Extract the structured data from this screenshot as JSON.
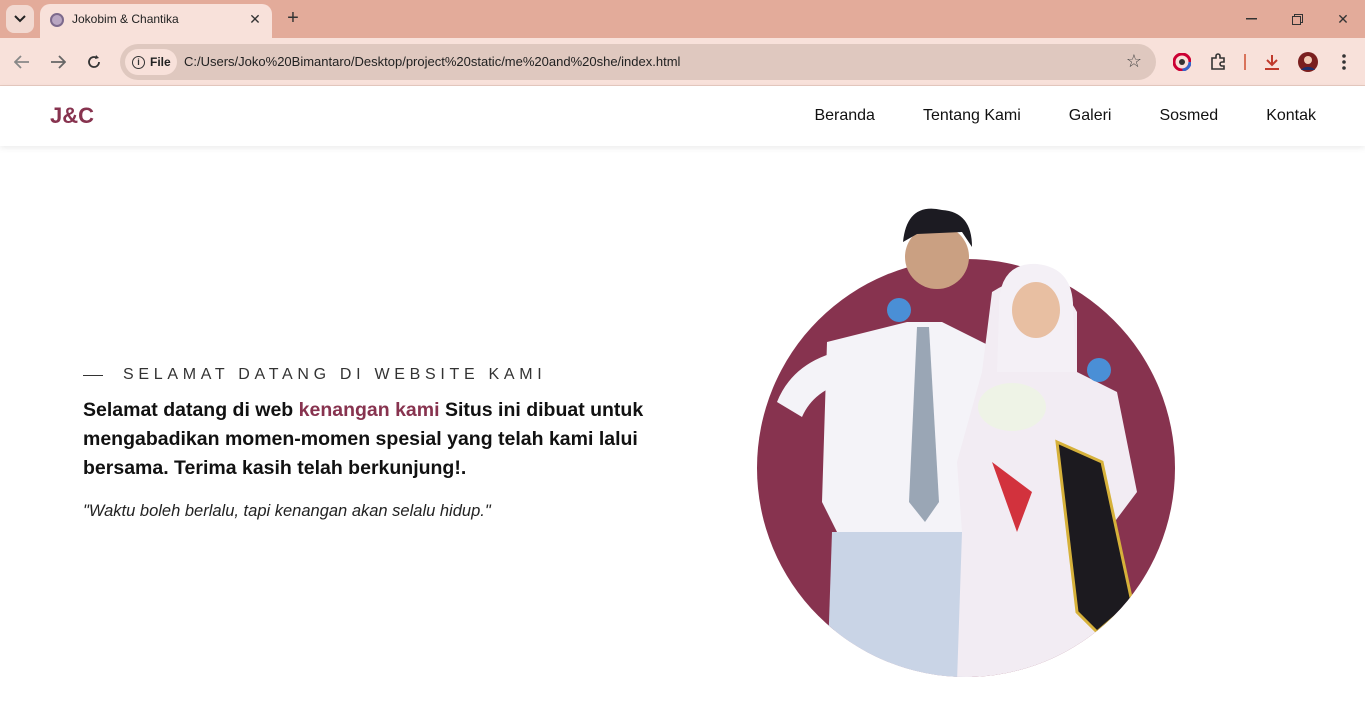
{
  "browser": {
    "tab_title": "Jokobim & Chantika",
    "file_label": "File",
    "url": "C:/Users/Joko%20Bimantaro/Desktop/project%20static/me%20and%20she/index.html"
  },
  "site": {
    "brand": "J&C",
    "menu": [
      "Beranda",
      "Tentang Kami",
      "Galeri",
      "Sosmed",
      "Kontak"
    ],
    "hero": {
      "eyebrow": "SELAMAT DATANG DI WEBSITE KAMI",
      "headline_before": "Selamat datang di web ",
      "headline_accent": "kenangan kami",
      "headline_after": " Situs ini dibuat untuk mengabadikan momen-momen spesial yang telah kami lalui bersama. Terima kasih telah berkunjung!.",
      "quote": "\"Waktu boleh berlalu, tapi kenangan akan selalu hidup.\""
    },
    "colors": {
      "accent": "#87334f",
      "chrome": "#e3ab9a"
    }
  }
}
